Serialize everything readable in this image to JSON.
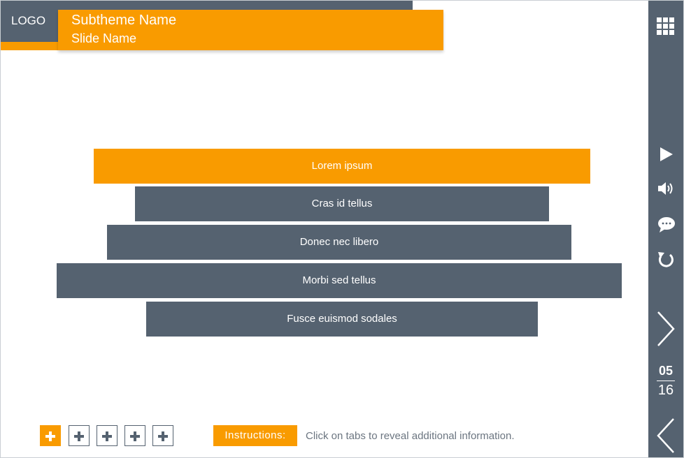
{
  "header": {
    "logo": "LOGO",
    "subtheme": "Subtheme Name",
    "slide_name": "Slide Name"
  },
  "colors": {
    "accent": "#f99b00",
    "slate": "#556270",
    "background": "#ffffff"
  },
  "tabs": [
    {
      "label": "Lorem ipsum",
      "active": true
    },
    {
      "label": "Cras id tellus",
      "active": false
    },
    {
      "label": "Donec nec libero",
      "active": false
    },
    {
      "label": "Morbi sed tellus",
      "active": false
    },
    {
      "label": "Fusce euismod sodales",
      "active": false
    }
  ],
  "sidebar": {
    "icons": [
      "grid-menu-icon",
      "play-icon",
      "volume-icon",
      "comment-icon",
      "replay-icon",
      "next-arrow-icon",
      "prev-arrow-icon"
    ],
    "page_current": "05",
    "page_total": "16"
  },
  "footer": {
    "instructions_label": "Instructions:",
    "instructions_text": "Click on tabs to reveal additional information."
  }
}
